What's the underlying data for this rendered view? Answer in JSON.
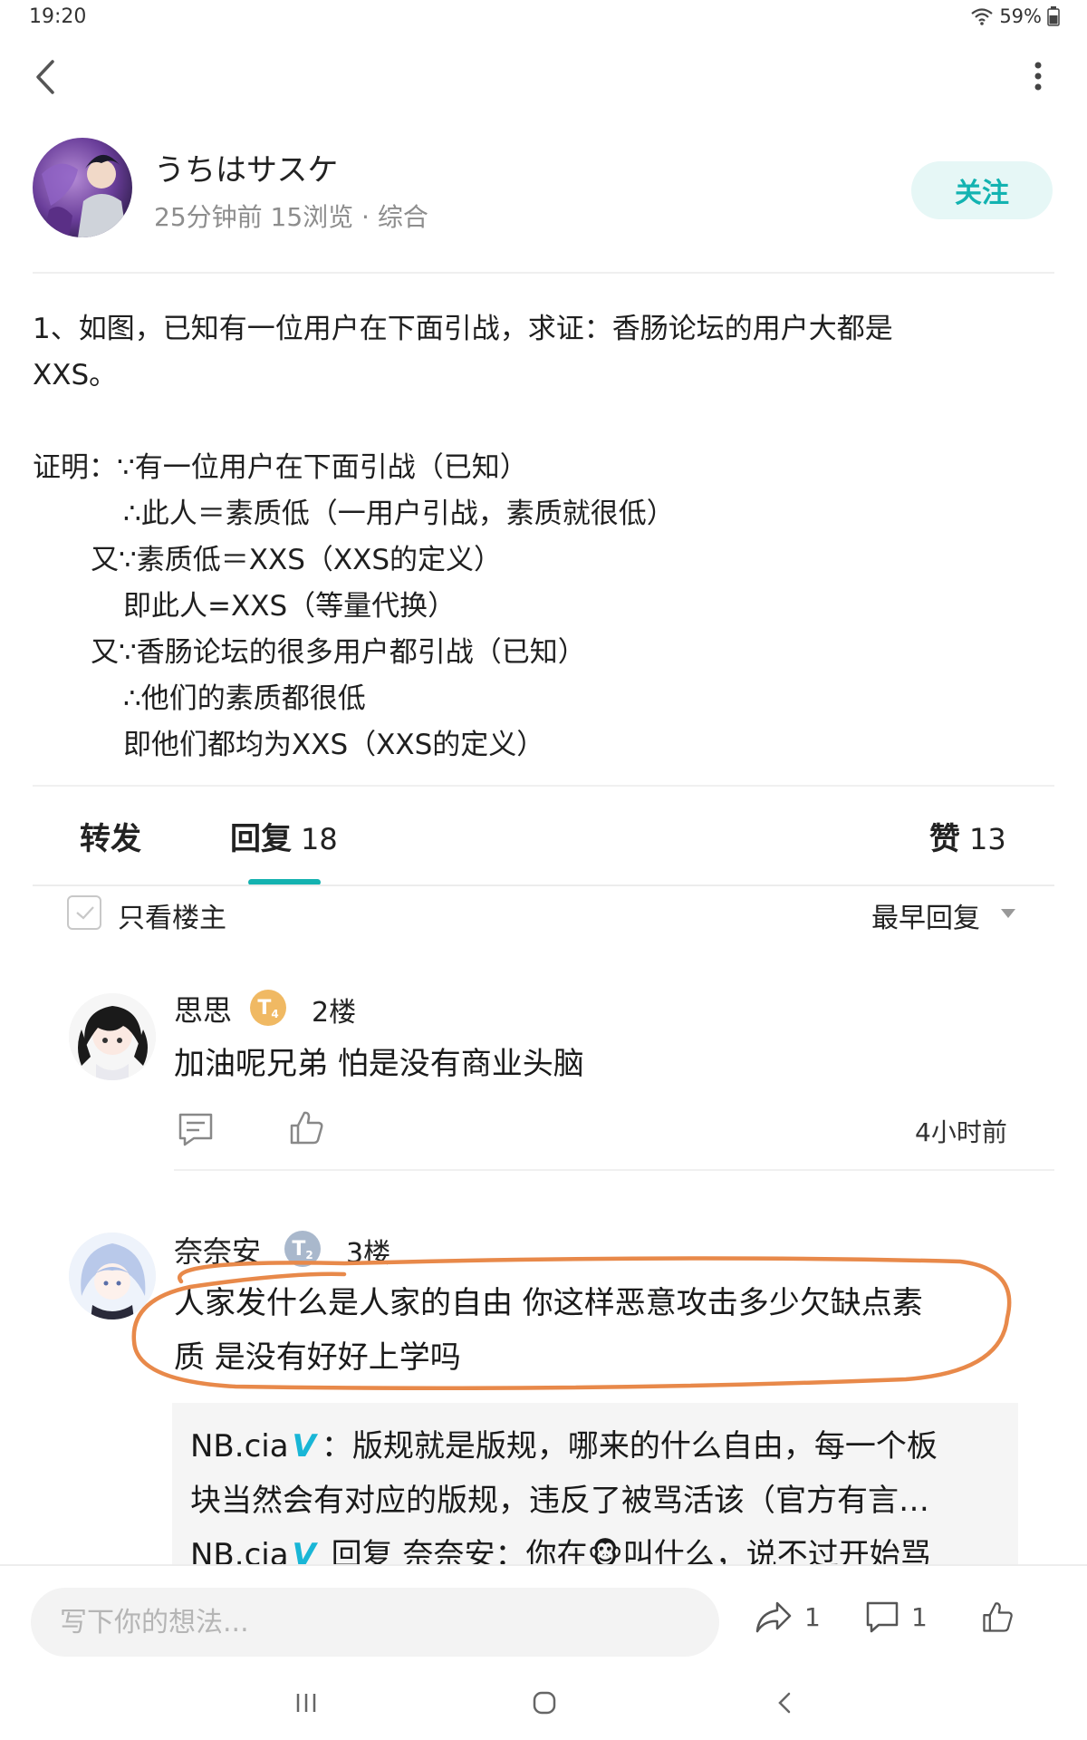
{
  "status_bar": {
    "time": "19:20",
    "battery": "59%"
  },
  "author": {
    "name": "うちはサスケ",
    "meta": "25分钟前 15浏览 · 综合",
    "follow_label": "关注"
  },
  "post": {
    "lines": [
      "1、如图，已知有一位用户在下面引战，求证：香肠论坛的用户大都是",
      "XXS。",
      "",
      "证明：∵有一位用户在下面引战（已知）",
      "∴此人＝素质低（一用户引战，素质就很低）",
      "又∵素质低＝XXS（XXS的定义）",
      "即此人=XXS（等量代换）",
      "又∵香肠论坛的很多用户都引战（已知）",
      "∴他们的素质都很低",
      "即他们都均为XXS（XXS的定义）"
    ]
  },
  "tabs": {
    "forward": "转发",
    "reply": "回复",
    "reply_count": "18",
    "like": "赞",
    "like_count": "13"
  },
  "filter": {
    "only_op": "只看楼主",
    "sort": "最早回复"
  },
  "comments": [
    {
      "name": "思思",
      "badge": "T",
      "badge_level": "4",
      "floor": "2楼",
      "text": "加油呢兄弟 怕是没有商业头脑",
      "time": "4小时前"
    },
    {
      "name": "奈奈安",
      "badge": "T",
      "badge_level": "2",
      "floor": "3楼",
      "text_line1": "人家发什么是人家的自由 你这样恶意攻击多少欠缺点素",
      "text_line2": "质 是没有好好上学吗",
      "replies": [
        {
          "user": "NB.cia",
          "v": "V",
          "text1": "：版规就是版规，哪来的什么自由，每一个板",
          "text2": "块当然会有对应的版规，违反了被骂活该（官方有言…"
        },
        {
          "user": "NB.cia",
          "v": "V",
          "text1": " 回复 奈奈安：你在🐵叫什么，说不过开始骂"
        }
      ]
    }
  ],
  "bottom_bar": {
    "placeholder": "写下你的想法...",
    "share_count": "1",
    "comment_count": "1"
  },
  "colors": {
    "accent": "#14b2b0",
    "follow_bg": "#e6f7f6",
    "highlight": "#e8894a"
  }
}
